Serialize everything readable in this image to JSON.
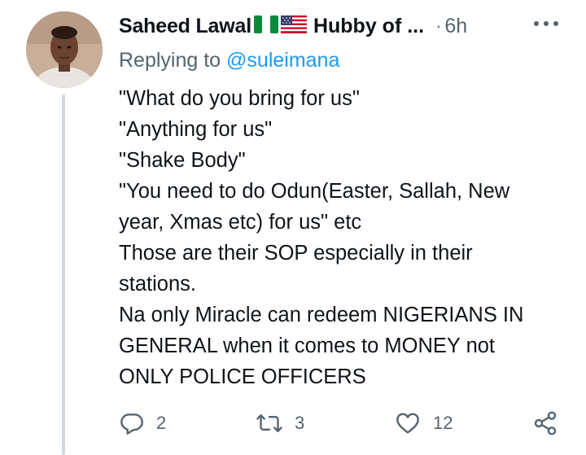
{
  "author": {
    "display_name": "Saheed Lawal",
    "flags": [
      "nigeria-flag-icon",
      "usa-flag-icon"
    ],
    "bio_snippet": "Hubby of ...",
    "separator": "·",
    "timestamp": "6h"
  },
  "reply_context": {
    "prefix": "Replying to",
    "handle": "@suleimana"
  },
  "tweet": {
    "lines": [
      "\"What do you bring for us\"",
      "\"Anything for us\"",
      "\"Shake Body\"",
      "\"You need to do Odun(Easter, Sallah, New",
      "year, Xmas etc) for us\" etc",
      "Those are their SOP especially in their",
      "stations.",
      "Na only Miracle can redeem NIGERIANS IN",
      "GENERAL when it comes to MONEY not",
      "ONLY POLICE OFFICERS"
    ]
  },
  "actions": {
    "reply_count": "2",
    "retweet_count": "3",
    "like_count": "12",
    "icons": [
      "reply-icon",
      "retweet-icon",
      "like-icon",
      "share-icon"
    ]
  },
  "colors": {
    "text": "#0f1419",
    "secondary": "#536471",
    "link": "#1d9bf0",
    "thread_line": "#cfd9de"
  }
}
